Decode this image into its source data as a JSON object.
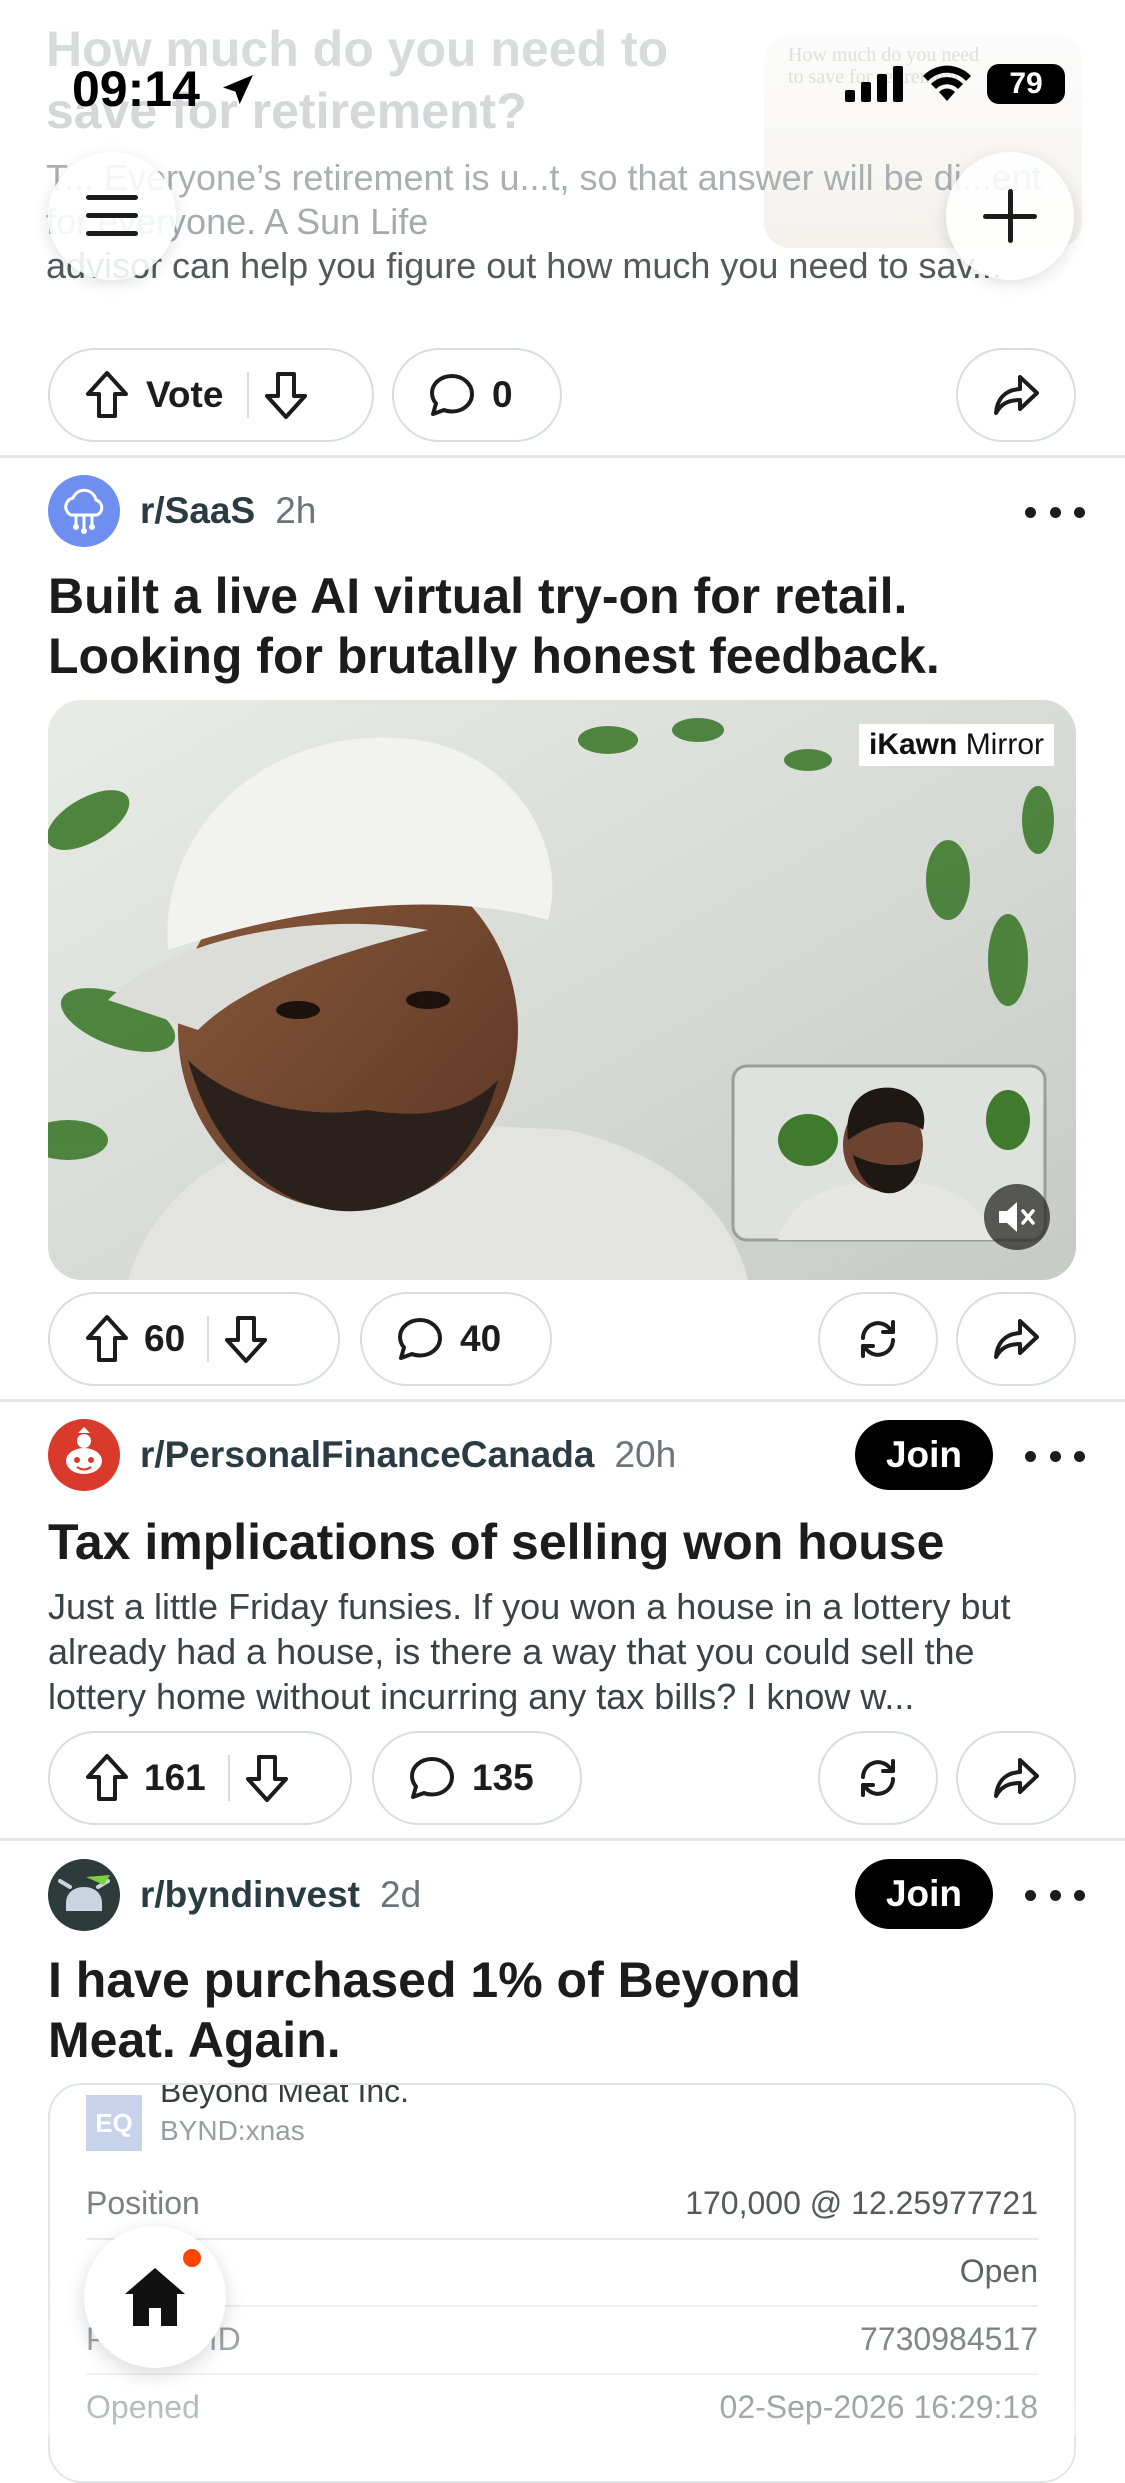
{
  "status_bar": {
    "time": "09:14",
    "battery": "79"
  },
  "ad": {
    "title": "How much do you need to save for retirement?",
    "body_faded": "T... Everyone’s retirement is u...t, so that answer will be di...ent for everyone. A Sun Life",
    "body_line": "advisor can help you figure out how much you need to sav...",
    "thumb_text": "How much do you need to save for retirement?",
    "vote_label": "Vote",
    "comments": "0"
  },
  "posts": [
    {
      "subreddit": "r/SaaS",
      "time": "2h",
      "title": "Built a live AI virtual try-on for retail. Looking for brutally honest feedback.",
      "media_watermark_brand": "iKawn",
      "media_watermark_word": "Mirror",
      "votes": "60",
      "comments": "40"
    },
    {
      "subreddit": "r/PersonalFinanceCanada",
      "time": "20h",
      "join_label": "Join",
      "title": "Tax implications of selling won house",
      "body": "Just a little Friday funsies. If you won a house in a lottery but already had a house, is there a way that you could sell the lottery home without incurring any tax bills? I know w...",
      "votes": "161",
      "comments": "135"
    },
    {
      "subreddit": "r/byndinvest",
      "time": "2d",
      "join_label": "Join",
      "title": "I have purchased 1% of Beyond Meat. Again.",
      "card": {
        "badge": "EQ",
        "company": "Beyond Meat Inc.",
        "ticker": "BYND:xnas",
        "rows": [
          {
            "label": "Position",
            "value": "170,000 @ 12.25977721"
          },
          {
            "label": "",
            "value": "Open"
          },
          {
            "label": "Position ID",
            "value": "7730984517"
          },
          {
            "label": "Opened",
            "value": "02-Sep-2026 16:29:18"
          }
        ]
      }
    }
  ],
  "colors": {
    "accent_notification": "#ff4500",
    "join_bg": "#000000",
    "pfc_avatar": "#d93a2b",
    "saas_avatar": "#6f8ff0"
  }
}
